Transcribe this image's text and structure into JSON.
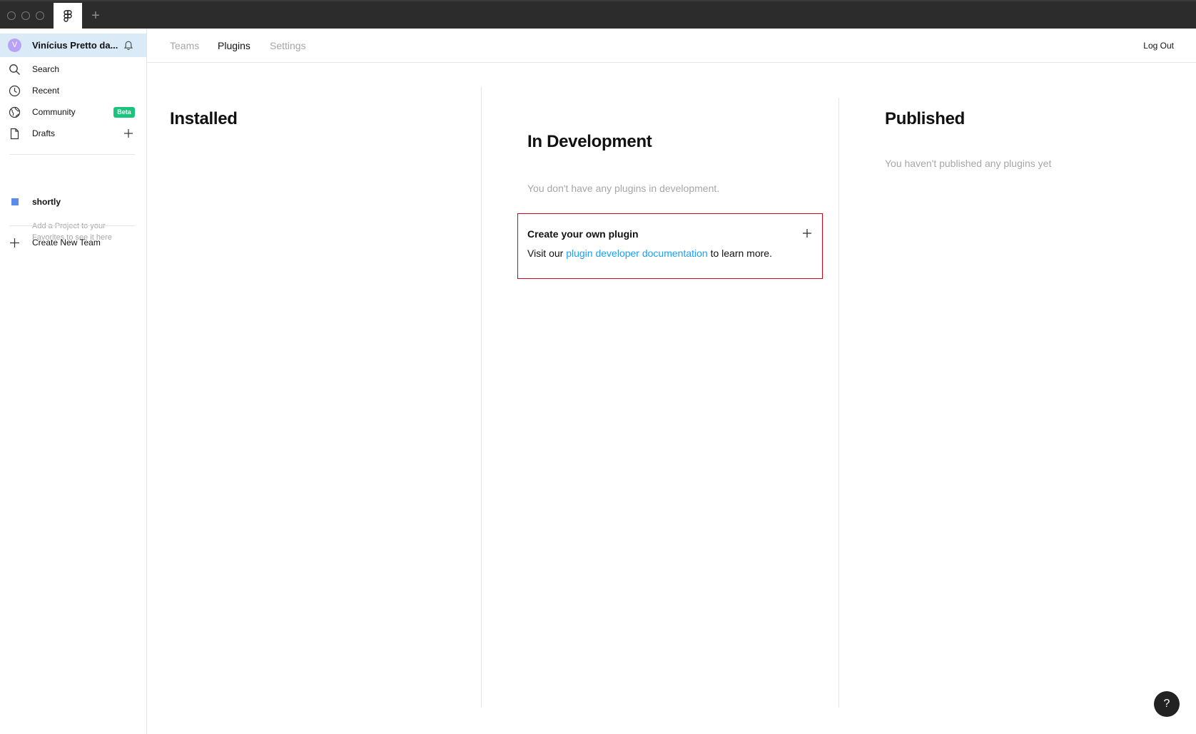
{
  "titlebar": {
    "new_tab_label": "+",
    "home_tab_icon": "figma-logo-icon"
  },
  "sidebar": {
    "user": {
      "avatar_initial": "V",
      "name": "Vinícius Pretto da...",
      "avatar_color": "#b8a2f5"
    },
    "items": [
      {
        "label": "Search",
        "icon": "search-icon"
      },
      {
        "label": "Recent",
        "icon": "clock-icon"
      },
      {
        "label": "Community",
        "icon": "globe-icon",
        "badge": "Beta"
      },
      {
        "label": "Drafts",
        "icon": "file-icon"
      }
    ],
    "team": {
      "name": "shortly",
      "color": "#5a8de8"
    },
    "favorites_hint": "Add a Project to your Favorites to see it here",
    "create_team_label": "Create New Team"
  },
  "topnav": {
    "tabs": [
      {
        "label": "Teams",
        "active": false
      },
      {
        "label": "Plugins",
        "active": true
      },
      {
        "label": "Settings",
        "active": false
      }
    ],
    "logout_label": "Log Out"
  },
  "columns": {
    "installed": {
      "title": "Installed"
    },
    "in_development": {
      "title": "In Development",
      "empty_text": "You don't have any plugins in development.",
      "card": {
        "title": "Create your own plugin",
        "body_prefix": "Visit our ",
        "link_text": "plugin developer documentation",
        "body_suffix": " to learn more."
      }
    },
    "published": {
      "title": "Published",
      "empty_text": "You haven't published any plugins yet"
    }
  },
  "help_label": "?",
  "colors": {
    "accent_link": "#18a0fb",
    "beta_badge": "#1bc47d",
    "highlight_border": "#d0021b",
    "selected_row": "#daebf7"
  }
}
